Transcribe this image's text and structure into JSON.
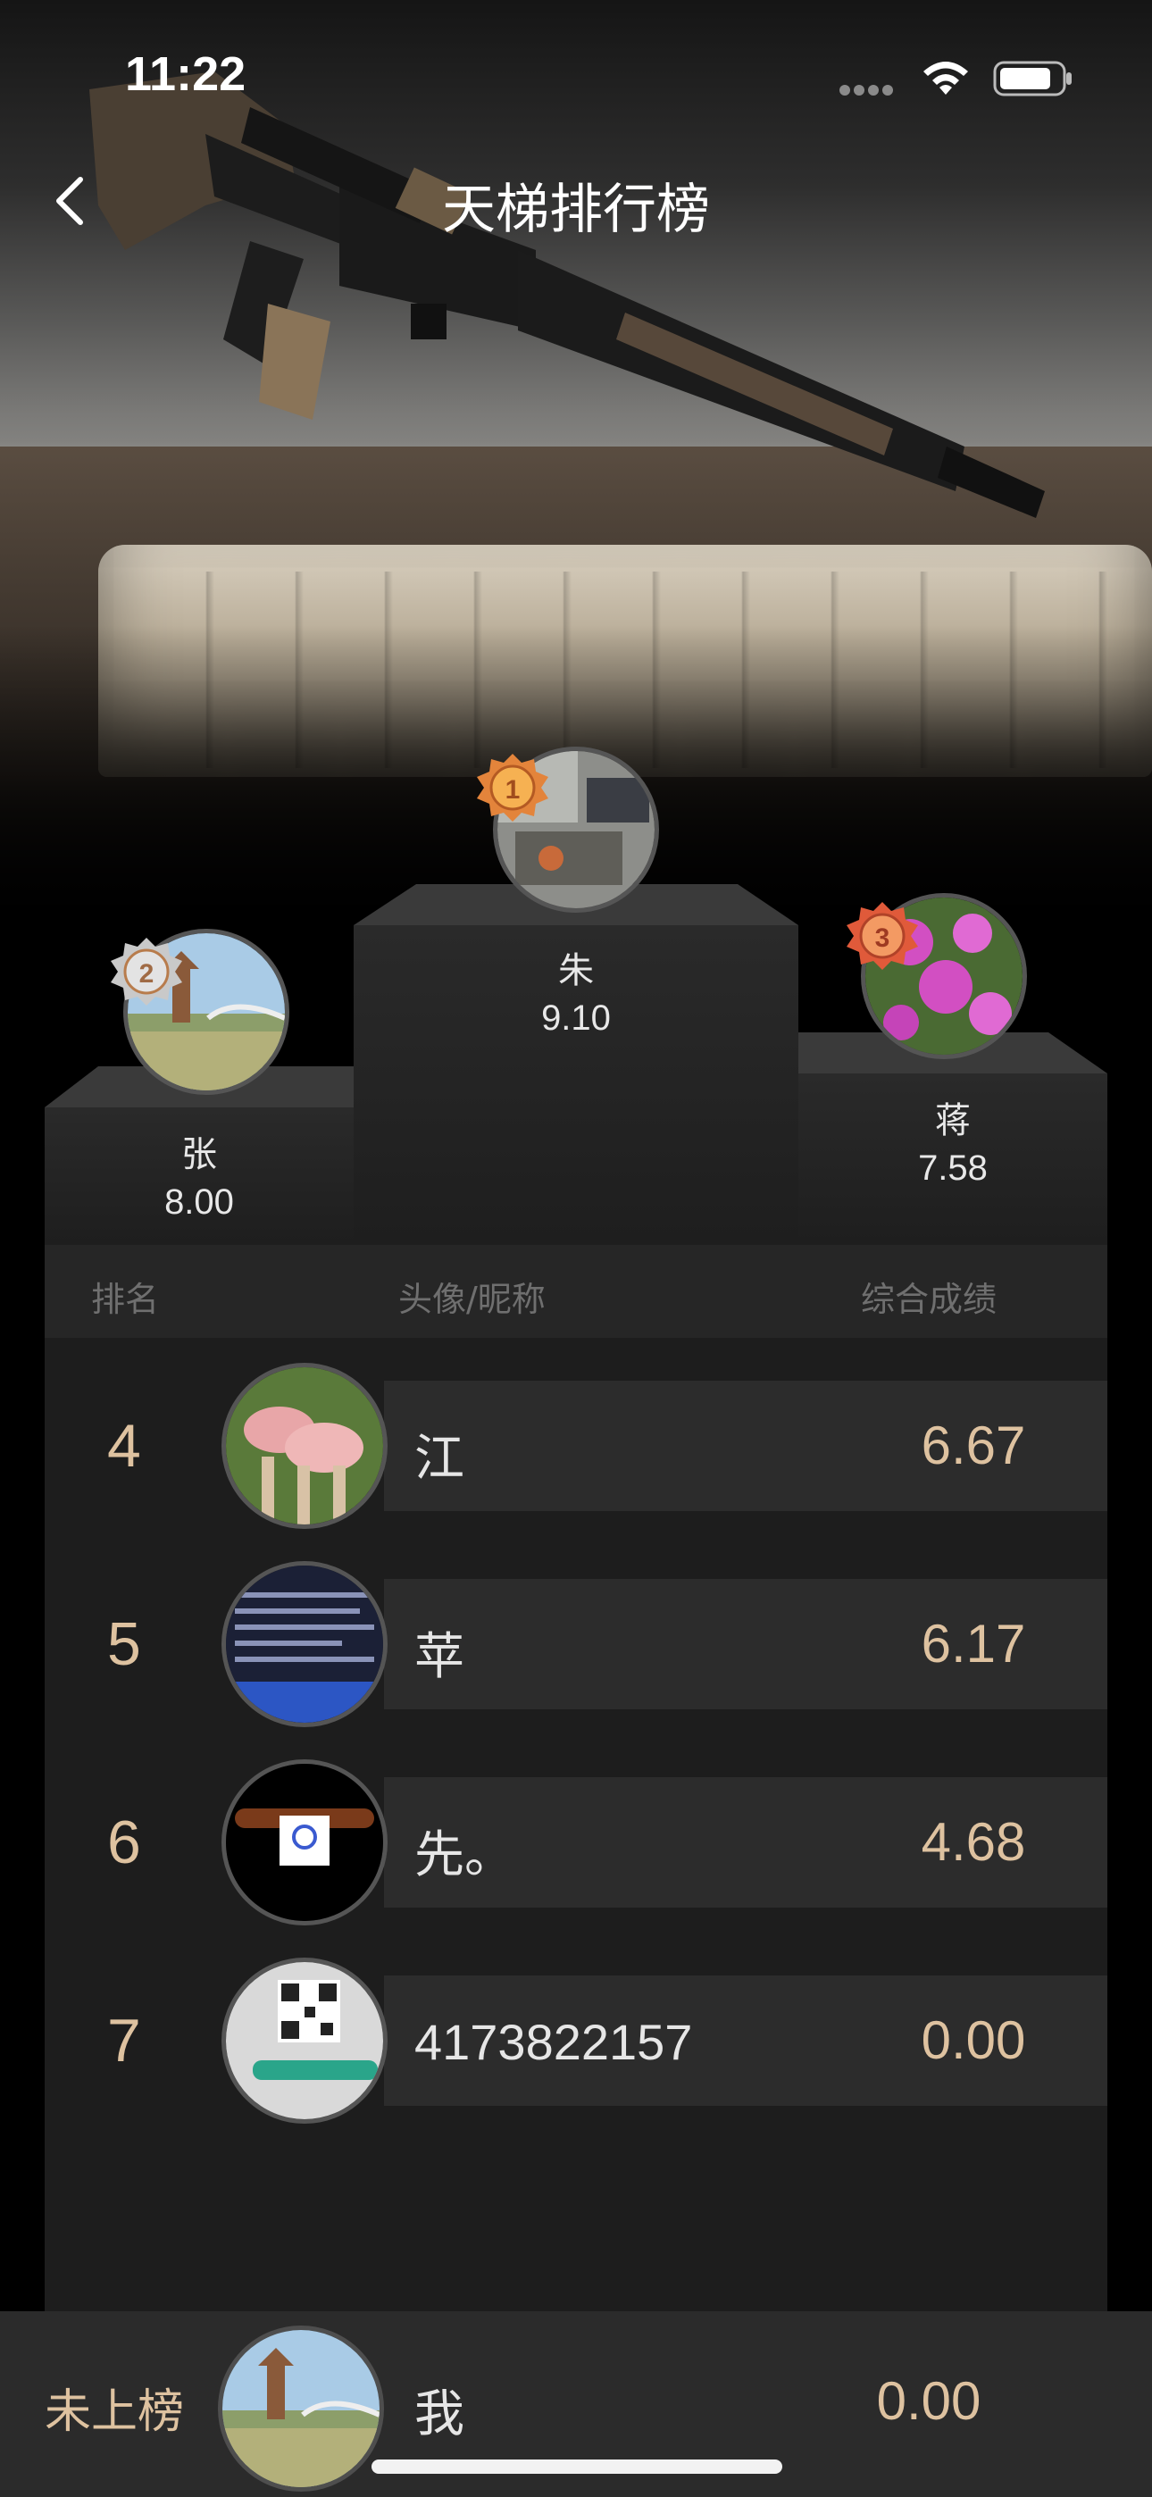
{
  "status_bar": {
    "time": "11:22"
  },
  "nav": {
    "title": "天梯排行榜",
    "back_icon": "chevron-left-icon"
  },
  "podium": {
    "first": {
      "medal": "1",
      "name": "朱",
      "score": "9.10"
    },
    "second": {
      "medal": "2",
      "name": "张",
      "score": "8.00"
    },
    "third": {
      "medal": "3",
      "name": "蒋",
      "score": "7.58"
    }
  },
  "table_header": {
    "rank": "排名",
    "avatar_nickname": "头像/昵称",
    "score": "综合成绩"
  },
  "rows": [
    {
      "rank": "4",
      "name": "江",
      "score": "6.67"
    },
    {
      "rank": "5",
      "name": "苹",
      "score": "6.17"
    },
    {
      "rank": "6",
      "name": "先。",
      "score": "4.68"
    },
    {
      "rank": "7",
      "name": "4173822157",
      "score": "0.00"
    }
  ],
  "me": {
    "label": "未上榜",
    "name": "我",
    "score": "0.00"
  },
  "colors": {
    "accent_gold": "#dec2a0",
    "background": "#000000",
    "row_bar": "#2c2c2c",
    "bottom_bar": "#2b2b2b"
  }
}
